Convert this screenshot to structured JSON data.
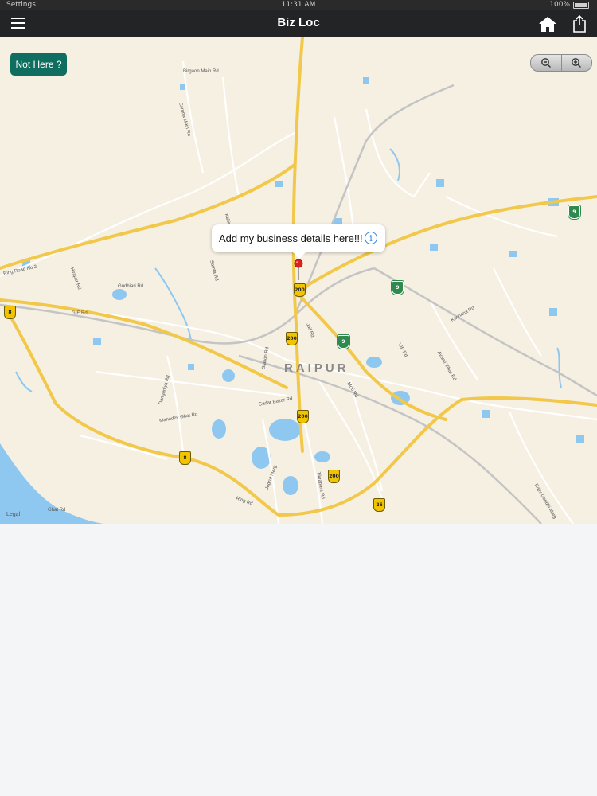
{
  "status_bar": {
    "carrier": "Settings",
    "time": "11:31 AM",
    "battery": "100%"
  },
  "nav": {
    "title": "Biz Loc"
  },
  "map": {
    "not_here_label": "Not Here ?",
    "callout_text": "Add my business details here!!!",
    "info_glyph": "i",
    "city_label": "RAIPUR",
    "legal_label": "Legal",
    "road_labels": [
      "Birgaon Main Rd",
      "Sarona Main Rd",
      "Ring Road No 2",
      "Hirapur Rd",
      "Gudhiari Rd",
      "G E Rd",
      "Jail Rd",
      "Station Rd",
      "Sadar Bazar Rd",
      "Mahadev Ghat Rd",
      "Danganiya Rd",
      "Moti Rd",
      "Jagrut Marg",
      "Tikrapara Rd",
      "Ring Rd",
      "Ghat Rd",
      "Kachana Rd",
      "Rajiv Gandhi Marg",
      "Avanti Vihar Rd",
      "VIP Rd",
      "Samta Rd",
      "Kabir Rd"
    ],
    "shields": [
      {
        "label": "8",
        "kind": "yellow"
      },
      {
        "label": "200",
        "kind": "yellow"
      },
      {
        "label": "200",
        "kind": "yellow"
      },
      {
        "label": "200",
        "kind": "yellow"
      },
      {
        "label": "200",
        "kind": "yellow"
      },
      {
        "label": "8",
        "kind": "yellow"
      },
      {
        "label": "26",
        "kind": "yellow"
      },
      {
        "label": "9",
        "kind": "green"
      },
      {
        "label": "9",
        "kind": "green"
      },
      {
        "label": "9",
        "kind": "green"
      }
    ],
    "colors": {
      "land": "#f6f0e3",
      "water": "#8ec8f0",
      "highway": "#f2c84b",
      "road": "#ffffff",
      "button": "#0f6e5f"
    }
  },
  "icons": {
    "menu": "hamburger-icon",
    "home": "home-icon",
    "share": "share-icon",
    "zoom_out": "zoom-out-icon",
    "zoom_in": "zoom-in-icon",
    "pin": "map-pin-icon",
    "info": "info-icon"
  }
}
